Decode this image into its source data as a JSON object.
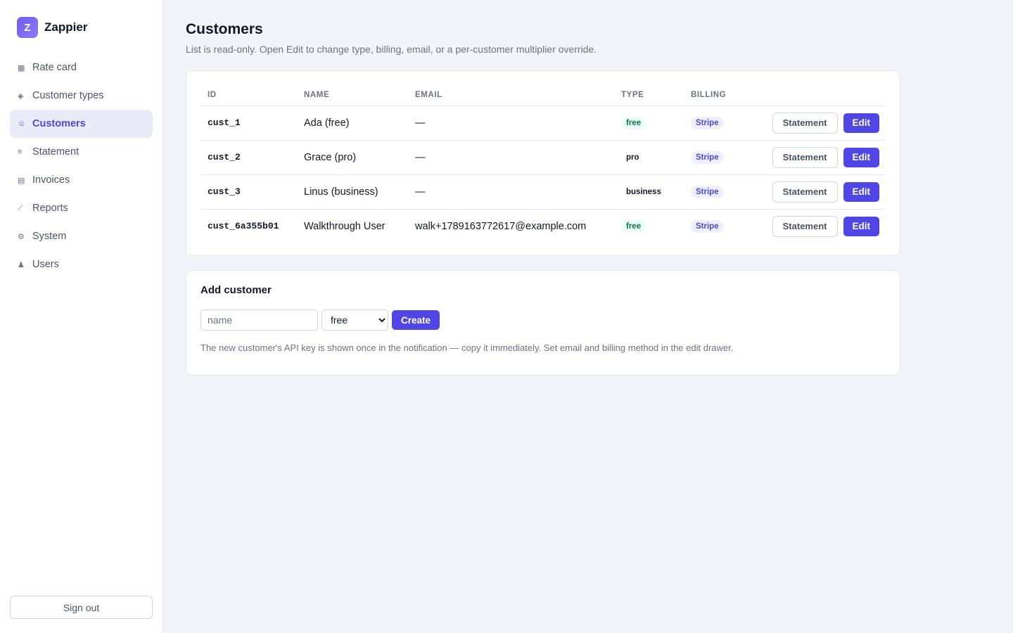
{
  "app": {
    "name": "Zappier",
    "logo_letter": "Z"
  },
  "sidebar": {
    "items": [
      {
        "label": "Rate card",
        "icon": "▦"
      },
      {
        "label": "Customer types",
        "icon": "◈"
      },
      {
        "label": "Customers",
        "icon": "☺"
      },
      {
        "label": "Statement",
        "icon": "≡"
      },
      {
        "label": "Invoices",
        "icon": "▤"
      },
      {
        "label": "Reports",
        "icon": "⟋"
      },
      {
        "label": "System",
        "icon": "⚙"
      },
      {
        "label": "Users",
        "icon": "♟"
      }
    ],
    "active": "Customers",
    "signout_label": "Sign out"
  },
  "page": {
    "title": "Customers",
    "subtitle": "List is read-only. Open Edit to change type, billing, email, or a per-customer multiplier override."
  },
  "table": {
    "headers": {
      "id": "ID",
      "name": "NAME",
      "email": "EMAIL",
      "type": "TYPE",
      "billing": "BILLING"
    },
    "rows": [
      {
        "id": "cust_1",
        "name": "Ada (free)",
        "email": "—",
        "type": "free",
        "billing": "Stripe",
        "statement": "Statement",
        "edit": "Edit"
      },
      {
        "id": "cust_2",
        "name": "Grace (pro)",
        "email": "—",
        "type": "pro",
        "billing": "Stripe",
        "statement": "Statement",
        "edit": "Edit"
      },
      {
        "id": "cust_3",
        "name": "Linus (business)",
        "email": "—",
        "type": "business",
        "billing": "Stripe",
        "statement": "Statement",
        "edit": "Edit"
      },
      {
        "id": "cust_6a355b01",
        "name": "Walkthrough User",
        "email": "walk+1789163772617@example.com",
        "type": "free",
        "billing": "Stripe",
        "statement": "Statement",
        "edit": "Edit"
      }
    ]
  },
  "add": {
    "title": "Add customer",
    "name_placeholder": "name",
    "type_selected": "free",
    "create_label": "Create",
    "note": "The new customer's API key is shown once in the notification — copy it immediately. Set email and billing method in the edit drawer."
  },
  "colors": {
    "accent": "#4f46e5",
    "free_badge": "#047857",
    "background": "#f3f4f9"
  }
}
